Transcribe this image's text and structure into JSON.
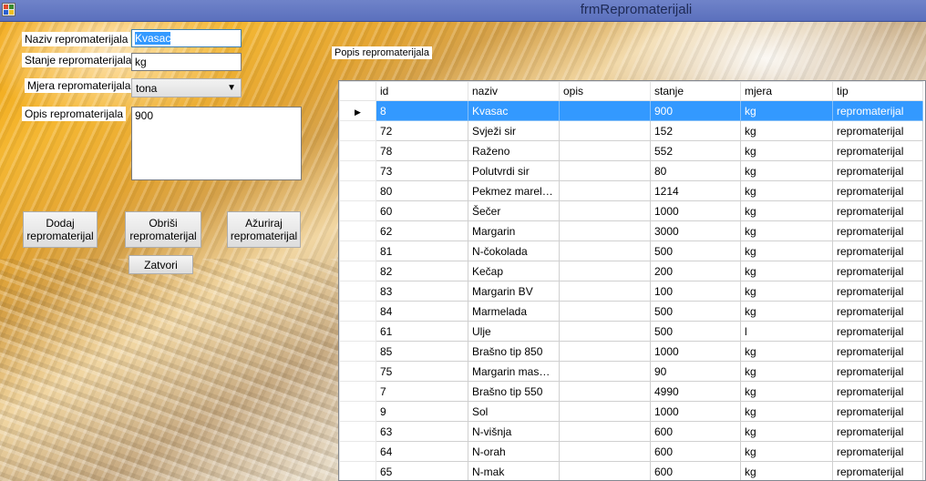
{
  "window": {
    "title": "frmRepromaterijali"
  },
  "form": {
    "naziv_label": "Naziv repromaterijala",
    "naziv_value": "Kvasac",
    "stanje_label": "Stanje repromaterijala",
    "stanje_value": "kg",
    "mjera_label": "Mjera repromaterijala",
    "mjera_value": "tona",
    "opis_label": "Opis repromaterijala",
    "opis_value": "900"
  },
  "buttons": {
    "dodaj_line1": "Dodaj",
    "dodaj_line2": "repromaterijal",
    "obrisi_line1": "Obriši",
    "obrisi_line2": "repromaterijal",
    "azuriraj_line1": "Ažuriraj",
    "azuriraj_line2": "repromaterijal",
    "zatvori": "Zatvori"
  },
  "grid": {
    "label": "Popis repromaterijala",
    "columns": [
      "id",
      "naziv",
      "opis",
      "stanje",
      "mjera",
      "tip"
    ],
    "selected_row": 0,
    "rows": [
      [
        "8",
        "Kvasac",
        "",
        "900",
        "kg",
        "repromaterijal"
      ],
      [
        "72",
        "Svježi sir",
        "",
        "152",
        "kg",
        "repromaterijal"
      ],
      [
        "78",
        "Raženo",
        "",
        "552",
        "kg",
        "repromaterijal"
      ],
      [
        "73",
        "Polutvrdi sir",
        "",
        "80",
        "kg",
        "repromaterijal"
      ],
      [
        "80",
        "Pekmez marelica",
        "",
        "1214",
        "kg",
        "repromaterijal"
      ],
      [
        "60",
        "Šečer",
        "",
        "1000",
        "kg",
        "repromaterijal"
      ],
      [
        "62",
        "Margarin",
        "",
        "3000",
        "kg",
        "repromaterijal"
      ],
      [
        "81",
        "N-čokolada",
        "",
        "500",
        "kg",
        "repromaterijal"
      ],
      [
        "82",
        "Kečap",
        "",
        "200",
        "kg",
        "repromaterijal"
      ],
      [
        "83",
        "Margarin BV",
        "",
        "100",
        "kg",
        "repromaterijal"
      ],
      [
        "84",
        "Marmelada",
        "",
        "500",
        "kg",
        "repromaterijal"
      ],
      [
        "61",
        "Ulje",
        "",
        "500",
        "l",
        "repromaterijal"
      ],
      [
        "85",
        "Brašno tip 850",
        "",
        "1000",
        "kg",
        "repromaterijal"
      ],
      [
        "75",
        "Margarin masono...",
        "",
        "90",
        "kg",
        "repromaterijal"
      ],
      [
        "7",
        "Brašno tip 550",
        "",
        "4990",
        "kg",
        "repromaterijal"
      ],
      [
        "9",
        "Sol",
        "",
        "1000",
        "kg",
        "repromaterijal"
      ],
      [
        "63",
        "N-višnja",
        "",
        "600",
        "kg",
        "repromaterijal"
      ],
      [
        "64",
        "N-orah",
        "",
        "600",
        "kg",
        "repromaterijal"
      ],
      [
        "65",
        "N-mak",
        "",
        "600",
        "kg",
        "repromaterijal"
      ]
    ]
  }
}
